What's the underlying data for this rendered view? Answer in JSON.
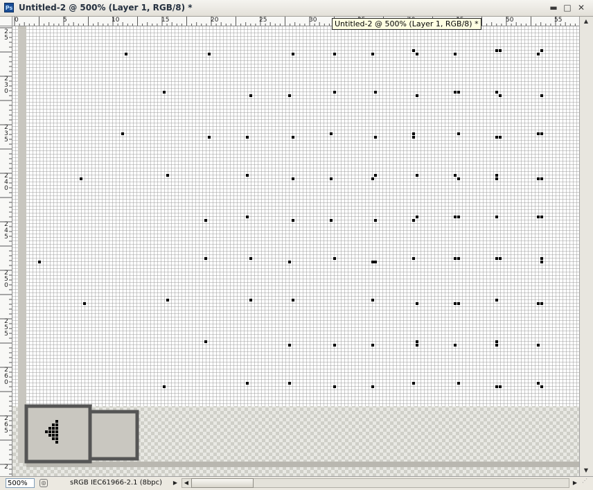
{
  "window": {
    "app_icon": "Ps",
    "title": "Untitled-2 @ 500% (Layer 1, RGB/8) *",
    "minimize_glyph": "▬",
    "maximize_glyph": "□",
    "close_glyph": "✕"
  },
  "tooltip": {
    "text": "Untitled-2 @ 500% (Layer 1, RGB/8) *"
  },
  "ruler_top": {
    "labels": [
      "0",
      "5",
      "10",
      "15",
      "20",
      "25",
      "30",
      "35",
      "40",
      "45",
      "50",
      "55"
    ]
  },
  "ruler_left": {
    "labels": [
      "25",
      "230",
      "235",
      "240",
      "245",
      "250",
      "255",
      "260",
      "265",
      "2"
    ]
  },
  "status_bar": {
    "zoom": "500%",
    "doc_info": "sRGB IEC61966-2.1 (8bpc)",
    "arrow_right": "▶",
    "arrow_left": "◀",
    "arrow_right2": "▶"
  },
  "scrollbar": {
    "up": "▲",
    "down": "▼"
  },
  "colors": {
    "grid_line": "#9a9a9a",
    "pixel": "#000000",
    "canvas_bg": "#ffffff",
    "pasteboard": "#c8c8c0"
  }
}
